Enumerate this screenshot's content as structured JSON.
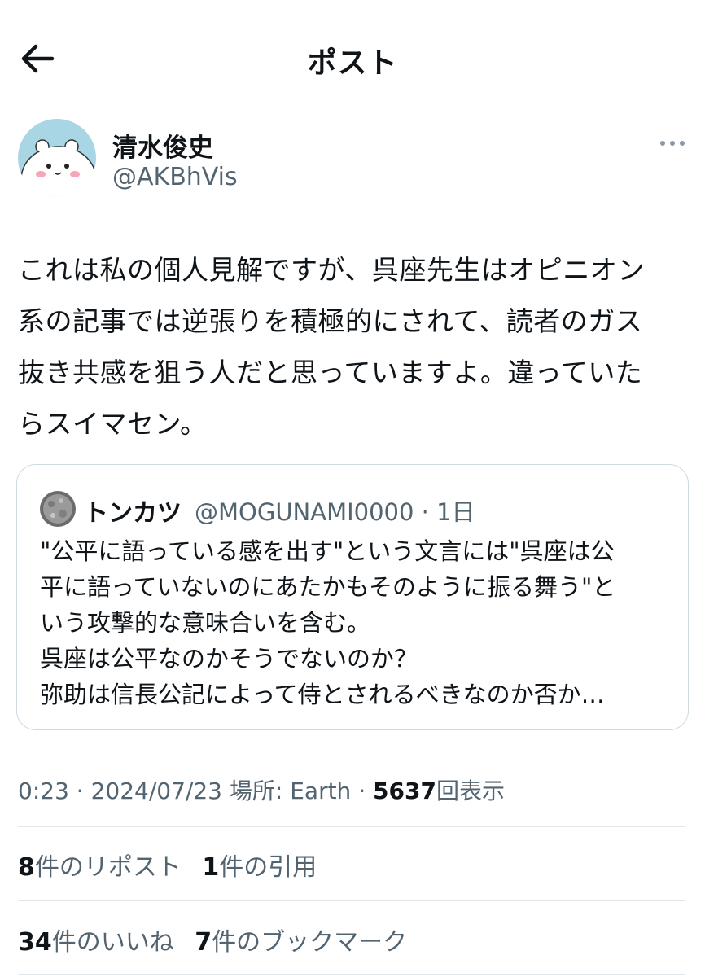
{
  "header": {
    "title": "ポスト"
  },
  "author": {
    "display_name": "清水俊史",
    "handle": "@AKBhVis"
  },
  "post": {
    "lines": [
      "これは私の個人見解ですが、呉座先生はオピニオン",
      "系の記事では逆張りを積極的にされて、読者のガス",
      "抜き共感を狙う人だと思っていますよ。違っていた",
      "らスイマセン。"
    ]
  },
  "quote": {
    "name": "トンカツ",
    "handle_time": "@MOGUNAMI0000 · 1日",
    "lines": [
      "\"公平に語っている感を出す\"という文言には\"呉座は公",
      "平に語っていないのにあたかもそのように振る舞う\"と",
      "いう攻撃的な意味合いを含む。",
      "呉座は公平なのかそうでないのか？",
      "弥助は信長公記によって侍とされるべきなのか否か…"
    ]
  },
  "meta": {
    "time": "0:23",
    "sep1": " · ",
    "date": "2024/07/23",
    "location": " 場所: Earth",
    "sep2": " · ",
    "views_count": "5637",
    "views_label": "回表示"
  },
  "stats": {
    "reposts_count": "8",
    "reposts_label": "件のリポスト",
    "quotes_count": "1",
    "quotes_label": "件の引用",
    "likes_count": "34",
    "likes_label": "件のいいね",
    "bookmarks_count": "7",
    "bookmarks_label": "件のブックマーク"
  },
  "icons": {
    "back": "arrow-left-icon",
    "more": "more-dots-icon"
  },
  "colors": {
    "text": "#0f1419",
    "secondary": "#536471",
    "border": "#cfd9de",
    "avatar_bg": "#a9d6e5"
  }
}
